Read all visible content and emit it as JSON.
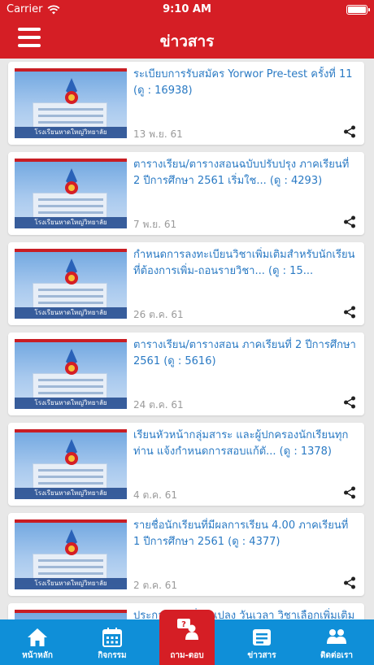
{
  "status_bar": {
    "carrier": "Carrier",
    "time": "9:10 AM"
  },
  "header": {
    "title": "ข่าวสาร"
  },
  "news": [
    {
      "title": "ระเบียบการรับสมัคร Yorwor Pre-test ครั้งที่ 11 (ดู : 16938)",
      "date": "13 พ.ย. 61",
      "thumb_label": "โรงเรียนหาดใหญ่วิทยาลัย"
    },
    {
      "title": "ตารางเรียน/ตารางสอนฉบับปรับปรุง ภาคเรียนที่ 2 ปีการศึกษา 2561 เริ่มใช... (ดู : 4293)",
      "date": "7 พ.ย. 61",
      "thumb_label": "โรงเรียนหาดใหญ่วิทยาลัย"
    },
    {
      "title": "กำหนดการลงทะเบียนวิชาเพิ่มเติมสำหรับนักเรียนที่ต้องการเพิ่ม-ถอนรายวิชา... (ดู : 15...",
      "date": "26 ต.ค. 61",
      "thumb_label": "โรงเรียนหาดใหญ่วิทยาลัย"
    },
    {
      "title": "ตารางเรียน/ตารางสอน ภาคเรียนที่ 2 ปีการศึกษา 2561 (ดู : 5616)",
      "date": "24 ต.ค. 61",
      "thumb_label": "โรงเรียนหาดใหญ่วิทยาลัย"
    },
    {
      "title": "เรียนหัวหน้ากลุ่มสาระ และผู้ปกครองนักเรียนทุกท่าน แจ้งกำหนดการสอบแก้ตั... (ดู : 1378)",
      "date": "4 ต.ค. 61",
      "thumb_label": "โรงเรียนหาดใหญ่วิทยาลัย"
    },
    {
      "title": "รายชื่อนักเรียนที่มีผลการเรียน 4.00 ภาคเรียนที่ 1 ปีการศึกษา 2561 (ดู : 4377)",
      "date": "2 ต.ค. 61",
      "thumb_label": "โรงเรียนหาดใหญ่วิทยาลัย"
    },
    {
      "title": "ประกาศ...เปลี่ยนแปลง วันเวลา วิชาเลือกเพิ่มเติม",
      "date": "",
      "thumb_label": ""
    }
  ],
  "tabs": [
    {
      "label": "หน้าหลัก",
      "icon": "home-icon"
    },
    {
      "label": "กิจกรรม",
      "icon": "calendar-icon"
    },
    {
      "label": "ถาม-ตอบ",
      "icon": "question-answer-icon"
    },
    {
      "label": "ข่าวสาร",
      "icon": "news-icon"
    },
    {
      "label": "ติดต่อเรา",
      "icon": "contact-icon"
    }
  ],
  "colors": {
    "header": "#d51e25",
    "tab_bar": "#0f8fd8",
    "title_link": "#2a7ac4",
    "active_tab": "#d51e25"
  }
}
